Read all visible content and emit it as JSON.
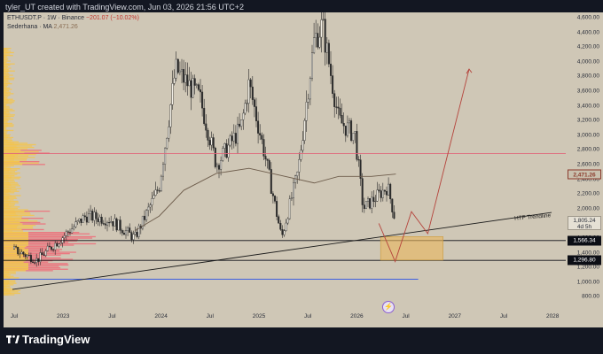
{
  "header": {
    "caption": "tyler_UT created with TradingView.com, Jun 03, 2026 21:56 UTC+2"
  },
  "legend": {
    "symbol": "ETHUSDT.P · 1W · Binance",
    "change": "−201.07 (−10.02%)",
    "ma_name": "Sederhana · MA",
    "ma_value": "2,471.26"
  },
  "price_axis": {
    "ticks": [
      "4,600.00",
      "4,400.00",
      "4,200.00",
      "4,000.00",
      "3,800.00",
      "3,600.00",
      "3,400.00",
      "3,200.00",
      "3,000.00",
      "2,800.00",
      "2,600.00",
      "2,400.00",
      "2,200.00",
      "2,000.00",
      "1,800.00",
      "1,600.00",
      "1,400.00",
      "1,200.00",
      "1,000.00",
      "800.00"
    ],
    "ma_label": "2,471.26",
    "current_label": "1,805.24",
    "current_countdown": "4d 5h",
    "level1_label": "1,566.34",
    "level2_label": "1,296.80"
  },
  "time_axis": {
    "ticks": [
      "Jul",
      "2023",
      "Jul",
      "2024",
      "Jul",
      "2025",
      "Jul",
      "2026",
      "Jul",
      "2027",
      "Jul",
      "2028"
    ]
  },
  "annotations": {
    "trendline_label": "HTF Trendline"
  },
  "colors": {
    "background": "#cfc7b6",
    "candles": "#2a2a2a",
    "ma": "#6e5d4c",
    "resistance": "#e0677a",
    "support_blue": "#3d5fe0",
    "projection": "#b5443c",
    "zone": "#e9b65c"
  },
  "footer": {
    "brand": "TradingView",
    "logo_icon": "tradingview-logo-icon"
  },
  "chart_data": {
    "type": "candlestick",
    "symbol": "ETHUSDT.P",
    "interval": "1W",
    "ylim": [
      800,
      4700
    ],
    "x": [
      "2022-07",
      "2022-10",
      "2023-01",
      "2023-04",
      "2023-07",
      "2023-10",
      "2024-01",
      "2024-03",
      "2024-06",
      "2024-08",
      "2024-11",
      "2024-12",
      "2025-02",
      "2025-04",
      "2025-06",
      "2025-08",
      "2025-09",
      "2025-11",
      "2026-01",
      "2026-02",
      "2026-04",
      "2026-05",
      "2026-06"
    ],
    "close": [
      1450,
      1300,
      1600,
      1900,
      1850,
      1600,
      2300,
      3900,
      3500,
      2600,
      3100,
      3700,
      2700,
      1600,
      2500,
      4300,
      4500,
      3200,
      3000,
      2000,
      2200,
      2300,
      1805
    ],
    "moving_average": {
      "name": "Sederhana · MA",
      "last_value": 2471.26
    },
    "levels": [
      {
        "price": 2750,
        "color": "#e0677a"
      },
      {
        "price": 1566.34,
        "label": "1,566.34"
      },
      {
        "price": 1296.8,
        "label": "1,296.80"
      },
      {
        "price": 1040,
        "color": "#3d5fe0"
      }
    ],
    "trendline": {
      "label": "HTF Trendline",
      "from": [
        "2022-07",
        900
      ],
      "to": [
        "2026-12",
        1900
      ]
    },
    "zone": {
      "from": "2026-05",
      "to": "2026-12",
      "price_range": [
        1300,
        1620
      ]
    },
    "projection": [
      [
        "2026-05",
        1800
      ],
      [
        "2026-07",
        1280
      ],
      [
        "2026-09",
        1960
      ],
      [
        "2026-11",
        1660
      ],
      [
        "2027-06",
        3900
      ]
    ],
    "volume_profile": true
  }
}
